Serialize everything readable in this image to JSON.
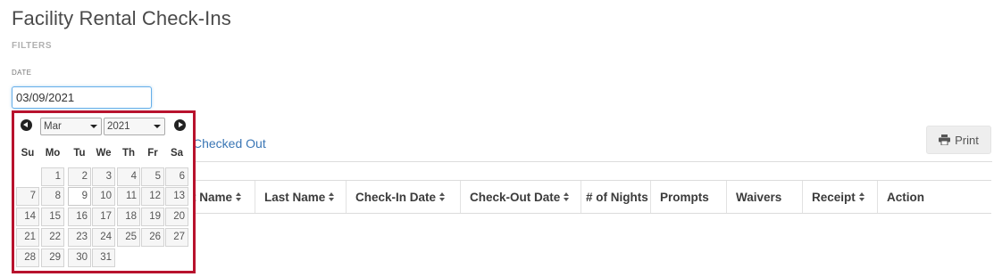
{
  "page": {
    "title": "Facility Rental Check-Ins",
    "filters_label": "FILTERS",
    "date_label": "DATE",
    "date_value": "03/09/2021"
  },
  "tabs": {
    "checked_out": "Checked Out"
  },
  "toolbar": {
    "print_label": "Print",
    "print_icon": "printer-icon"
  },
  "table": {
    "columns": [
      {
        "label": "t Name",
        "sortable": true
      },
      {
        "label": "Last Name",
        "sortable": true
      },
      {
        "label": "Check-In Date",
        "sortable": true
      },
      {
        "label": "Check-Out Date",
        "sortable": true
      },
      {
        "label": "# of Nights",
        "sortable": false
      },
      {
        "label": "Prompts",
        "sortable": false
      },
      {
        "label": "Waivers",
        "sortable": false
      },
      {
        "label": "Receipt",
        "sortable": true
      },
      {
        "label": "Action",
        "sortable": false
      }
    ]
  },
  "datepicker": {
    "month": "Mar",
    "year": "2021",
    "weekdays": [
      "Su",
      "Mo",
      "Tu",
      "We",
      "Th",
      "Fr",
      "Sa"
    ],
    "selected_day": "9",
    "highlight_color": "#b8122d",
    "weeks": [
      [
        "",
        "1",
        "2",
        "3",
        "4",
        "5",
        "6"
      ],
      [
        "7",
        "8",
        "9",
        "10",
        "11",
        "12",
        "13"
      ],
      [
        "14",
        "15",
        "16",
        "17",
        "18",
        "19",
        "20"
      ],
      [
        "21",
        "22",
        "23",
        "24",
        "25",
        "26",
        "27"
      ],
      [
        "28",
        "29",
        "30",
        "31",
        "",
        "",
        ""
      ]
    ]
  }
}
